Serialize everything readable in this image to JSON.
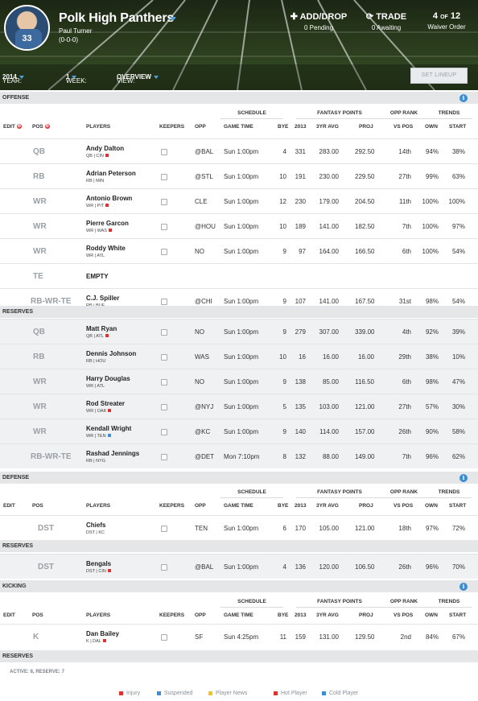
{
  "header": {
    "team_name": "Polk High Panthers",
    "owner": "Paul Turner",
    "record": "(0-0-0)",
    "avatar_number": "33",
    "add_drop": {
      "label": "ADD/DROP",
      "sub": "0 Pending"
    },
    "trade": {
      "label": "TRADE",
      "sub": "0 Awaiting"
    },
    "waiver": {
      "pos": "4",
      "of": "OF",
      "total": "12",
      "sub": "Waiver Order"
    },
    "year_label": "YEAR:",
    "year_value": "2014",
    "week_label": "WEEK:",
    "week_value": "1",
    "view_label": "VIEW:",
    "view_value": "OVERVIEW",
    "set_lineup": "SET LINEUP"
  },
  "columns": {
    "edit": "EDIT",
    "pos": "POS",
    "players": "PLAYERS",
    "keepers": "KEEPERS",
    "opp": "OPP",
    "game_time": "GAME TIME",
    "bye": "BYE",
    "y2013": "2013",
    "avg": "3YR AVG",
    "proj": "PROJ",
    "vs_pos": "VS POS",
    "own": "OWN",
    "start": "START",
    "schedule": "SCHEDULE",
    "fantasy_points": "FANTASY POINTS",
    "opp_rank": "OPP RANK",
    "trends": "TRENDS"
  },
  "sections": {
    "offense": "OFFENSE",
    "reserves": "RESERVES",
    "defense": "DEFENSE",
    "def_reserves": "RESERVES",
    "kicking": "KICKING",
    "kick_reserves": "RESERVES"
  },
  "offense": [
    {
      "pos": "QB",
      "name": "Andy Dalton",
      "meta": "QB | CIN",
      "tag": "hot",
      "opp": "@BAL",
      "time": "Sun 1:00pm",
      "bye": "4",
      "y2013": "331",
      "avg": "283.00",
      "proj": "292.50",
      "vs": "14th",
      "own": "94%",
      "start": "38%"
    },
    {
      "pos": "RB",
      "name": "Adrian Peterson",
      "meta": "RB | MIN",
      "tag": "",
      "opp": "@STL",
      "time": "Sun 1:00pm",
      "bye": "10",
      "y2013": "191",
      "avg": "230.00",
      "proj": "229.50",
      "vs": "27th",
      "own": "99%",
      "start": "63%"
    },
    {
      "pos": "WR",
      "name": "Antonio Brown",
      "meta": "WR | PIT",
      "tag": "hot",
      "opp": "CLE",
      "time": "Sun 1:00pm",
      "bye": "12",
      "y2013": "230",
      "avg": "179.00",
      "proj": "204.50",
      "vs": "11th",
      "own": "100%",
      "start": "100%"
    },
    {
      "pos": "WR",
      "name": "Pierre Garcon",
      "meta": "WR | WAS",
      "tag": "hot",
      "opp": "@HOU",
      "time": "Sun 1:00pm",
      "bye": "10",
      "y2013": "189",
      "avg": "141.00",
      "proj": "182.50",
      "vs": "7th",
      "own": "100%",
      "start": "97%"
    },
    {
      "pos": "WR",
      "name": "Roddy White",
      "meta": "WR | ATL",
      "tag": "",
      "opp": "NO",
      "time": "Sun 1:00pm",
      "bye": "9",
      "y2013": "97",
      "avg": "164.00",
      "proj": "166.50",
      "vs": "6th",
      "own": "100%",
      "start": "54%"
    },
    {
      "pos": "TE",
      "name": "EMPTY",
      "meta": "",
      "tag": "",
      "opp": "",
      "time": "",
      "bye": "",
      "y2013": "",
      "avg": "",
      "proj": "",
      "vs": "",
      "own": "",
      "start": ""
    },
    {
      "pos": "RB-WR-TE",
      "name": "C.J. Spiller",
      "meta": "RB | BUF",
      "tag": "",
      "opp": "@CHI",
      "time": "Sun 1:00pm",
      "bye": "9",
      "y2013": "107",
      "avg": "141.00",
      "proj": "167.50",
      "vs": "31st",
      "own": "98%",
      "start": "54%"
    }
  ],
  "reserves": [
    {
      "pos": "QB",
      "name": "Matt Ryan",
      "meta": "QB | ATL",
      "tag": "hot",
      "opp": "NO",
      "time": "Sun 1:00pm",
      "bye": "9",
      "y2013": "279",
      "avg": "307.00",
      "proj": "339.00",
      "vs": "4th",
      "own": "92%",
      "start": "39%"
    },
    {
      "pos": "RB",
      "name": "Dennis Johnson",
      "meta": "RB | HOU",
      "tag": "",
      "opp": "WAS",
      "time": "Sun 1:00pm",
      "bye": "10",
      "y2013": "16",
      "avg": "16.00",
      "proj": "16.00",
      "vs": "29th",
      "own": "38%",
      "start": "10%"
    },
    {
      "pos": "WR",
      "name": "Harry Douglas",
      "meta": "WR | ATL",
      "tag": "",
      "opp": "NO",
      "time": "Sun 1:00pm",
      "bye": "9",
      "y2013": "138",
      "avg": "85.00",
      "proj": "116.50",
      "vs": "6th",
      "own": "98%",
      "start": "47%"
    },
    {
      "pos": "WR",
      "name": "Rod Streater",
      "meta": "WR | OAK",
      "tag": "hot",
      "opp": "@NYJ",
      "time": "Sun 1:00pm",
      "bye": "5",
      "y2013": "135",
      "avg": "103.00",
      "proj": "121.00",
      "vs": "27th",
      "own": "57%",
      "start": "30%"
    },
    {
      "pos": "WR",
      "name": "Kendall Wright",
      "meta": "WR | TEN",
      "tag": "cold",
      "opp": "@KC",
      "time": "Sun 1:00pm",
      "bye": "9",
      "y2013": "140",
      "avg": "114.00",
      "proj": "157.00",
      "vs": "26th",
      "own": "90%",
      "start": "58%"
    },
    {
      "pos": "RB-WR-TE",
      "name": "Rashad Jennings",
      "meta": "RB | NYG",
      "tag": "",
      "opp": "@DET",
      "time": "Mon 7:10pm",
      "bye": "8",
      "y2013": "132",
      "avg": "88.00",
      "proj": "149.00",
      "vs": "7th",
      "own": "96%",
      "start": "62%"
    }
  ],
  "defense": [
    {
      "pos": "DST",
      "name": "Chiefs",
      "meta": "DST | KC",
      "tag": "",
      "opp": "TEN",
      "time": "Sun 1:00pm",
      "bye": "6",
      "y2013": "170",
      "avg": "105.00",
      "proj": "121.00",
      "vs": "18th",
      "own": "97%",
      "start": "72%"
    }
  ],
  "def_reserves": [
    {
      "pos": "DST",
      "name": "Bengals",
      "meta": "DST | CIN",
      "tag": "hot",
      "opp": "@BAL",
      "time": "Sun 1:00pm",
      "bye": "4",
      "y2013": "136",
      "avg": "120.00",
      "proj": "106.50",
      "vs": "26th",
      "own": "96%",
      "start": "70%"
    }
  ],
  "kicking": [
    {
      "pos": "K",
      "name": "Dan Bailey",
      "meta": "K | DAL",
      "tag": "hot",
      "opp": "SF",
      "time": "Sun 4:25pm",
      "bye": "11",
      "y2013": "159",
      "avg": "131.00",
      "proj": "129.50",
      "vs": "2nd",
      "own": "84%",
      "start": "67%"
    }
  ],
  "summary": "ACTIVE: 8, RESERVE: 7",
  "legend": [
    {
      "label": "Injury",
      "color": "#e03131",
      "icon": "injury-icon"
    },
    {
      "label": "Suspended",
      "color": "#3a8ed6",
      "icon": "suspended-icon"
    },
    {
      "label": "Player News",
      "color": "#f0c419",
      "icon": "news-icon"
    },
    {
      "label": "Hot Player",
      "color": "#e03131",
      "icon": "hot-icon"
    },
    {
      "label": "Cold Player",
      "color": "#3a8ed6",
      "icon": "cold-icon"
    }
  ],
  "colors": {
    "hot": "#e03131",
    "cold": "#3a8ed6",
    "accent": "#4fa3e4"
  }
}
